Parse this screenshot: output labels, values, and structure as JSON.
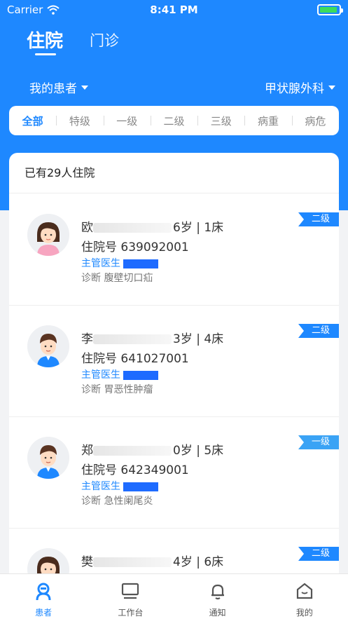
{
  "status_bar": {
    "carrier": "Carrier",
    "time": "8:41 PM"
  },
  "top_tabs": {
    "active": "住院",
    "inactive": "门诊"
  },
  "filters": {
    "my_patients": "我的患者",
    "department": "甲状腺外科"
  },
  "levels": [
    "全部",
    "特级",
    "一级",
    "二级",
    "三级",
    "病重",
    "病危"
  ],
  "list": {
    "count_text": "已有29人住院",
    "patients": [
      {
        "name_visible": "欧",
        "age_bed": "6岁 | 1床",
        "admission": "住院号 639092001",
        "doctor_label": "主管医生",
        "diagnosis": "诊断 腹壁切口疝",
        "level": "二级",
        "avatar": "female"
      },
      {
        "name_visible": "李",
        "age_bed": "3岁 | 4床",
        "admission": "住院号 641027001",
        "doctor_label": "主管医生",
        "diagnosis": "诊断 胃恶性肿瘤",
        "level": "二级",
        "avatar": "male"
      },
      {
        "name_visible": "郑",
        "age_bed": "0岁 | 5床",
        "admission": "住院号 642349001",
        "doctor_label": "主管医生",
        "diagnosis": "诊断 急性阑尾炎",
        "level": "一级",
        "avatar": "male"
      },
      {
        "name_visible": "樊",
        "age_bed": "4岁 | 6床",
        "admission": "",
        "doctor_label": "",
        "diagnosis": "",
        "level": "二级",
        "avatar": "female"
      }
    ]
  },
  "tab_bar": {
    "patients": "患者",
    "workbench": "工作台",
    "notify": "通知",
    "mine": "我的"
  },
  "colors": {
    "primary": "#1e88ff",
    "badge_level1": "#3aa3f5"
  }
}
